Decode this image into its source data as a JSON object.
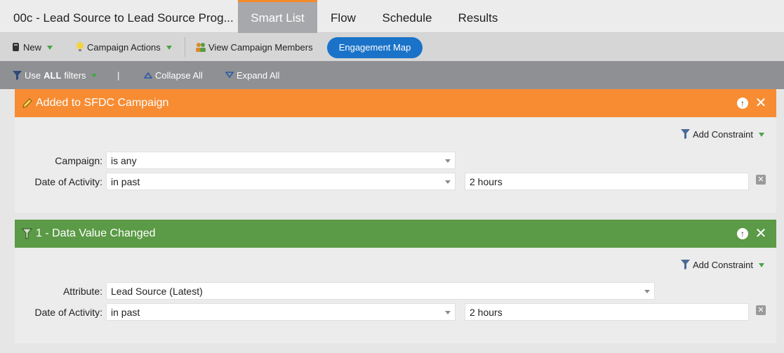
{
  "tabs": {
    "title": "00c - Lead Source to Lead Source Prog...",
    "smart_list": "Smart List",
    "flow": "Flow",
    "schedule": "Schedule",
    "results": "Results"
  },
  "toolbar": {
    "new_label": "New",
    "campaign_actions_label": "Campaign Actions",
    "view_members_label": "View Campaign Members",
    "engagement_map_label": "Engagement Map"
  },
  "filterbar": {
    "use_prefix": "Use",
    "use_all": "ALL",
    "use_suffix": "filters",
    "divider": "|",
    "collapse_all": "Collapse All",
    "expand_all": "Expand All"
  },
  "filters": [
    {
      "title": "Added to SFDC Campaign",
      "header_color": "#f78c33",
      "add_constraint": "Add Constraint",
      "field1_label": "Campaign:",
      "field1_value": "is any",
      "field2_label": "Date of Activity:",
      "field2_value": "in past",
      "field2_amount": "2 hours"
    },
    {
      "title": "1 - Data Value Changed",
      "header_color": "#5b9a46",
      "add_constraint": "Add Constraint",
      "field1_label": "Attribute:",
      "field1_value": "Lead Source (Latest)",
      "field2_label": "Date of Activity:",
      "field2_value": "in past",
      "field2_amount": "2 hours"
    }
  ],
  "colors": {
    "active_tab_accent": "#f58a2b",
    "engagement_button": "#1a73c8"
  }
}
